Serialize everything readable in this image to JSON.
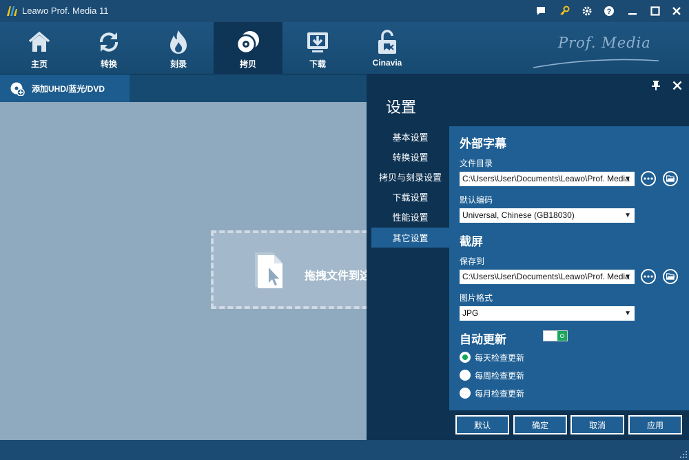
{
  "window": {
    "title": "Leawo Prof. Media 11",
    "controls": [
      "message-icon",
      "key-icon",
      "gear-icon",
      "help-icon",
      "minimize-icon",
      "maximize-icon",
      "close-icon"
    ]
  },
  "nav": {
    "items": [
      {
        "label": "主页",
        "icon": "home-icon"
      },
      {
        "label": "转换",
        "icon": "convert-icon"
      },
      {
        "label": "刻录",
        "icon": "burn-icon"
      },
      {
        "label": "拷贝",
        "icon": "copy-disc-icon",
        "active": true
      },
      {
        "label": "下载",
        "icon": "download-icon"
      },
      {
        "label": "Cinavia",
        "icon": "cinavia-unlock-icon"
      }
    ],
    "brand": "Prof. Media"
  },
  "left": {
    "add_disc_label": "添加UHD/蓝光/DVD",
    "drop_text": "拖拽文件到这"
  },
  "settings": {
    "title": "设置",
    "sidebar": [
      "基本设置",
      "转换设置",
      "拷贝与刻录设置",
      "下载设置",
      "性能设置",
      "其它设置"
    ],
    "active_index": 5,
    "external_subtitles": {
      "heading": "外部字幕",
      "dir_label": "文件目录",
      "dir_value": "C:\\Users\\User\\Documents\\Leawo\\Prof. Media",
      "encoding_label": "默认编码",
      "encoding_value": "Universal, Chinese (GB18030)"
    },
    "screenshot": {
      "heading": "截屏",
      "save_label": "保存到",
      "save_value": "C:\\Users\\User\\Documents\\Leawo\\Prof. Media",
      "format_label": "图片格式",
      "format_value": "JPG"
    },
    "auto_update": {
      "heading": "自动更新",
      "enabled": true,
      "options": [
        "每天检查更新",
        "每周检查更新",
        "每月检查更新"
      ],
      "selected_index": 0
    },
    "buttons": {
      "default": "默认",
      "ok": "确定",
      "cancel": "取消",
      "apply": "应用"
    }
  },
  "colors": {
    "accent_green": "#12a65a",
    "panel_dark": "#0e3252",
    "panel_blue": "#1f5f94"
  }
}
